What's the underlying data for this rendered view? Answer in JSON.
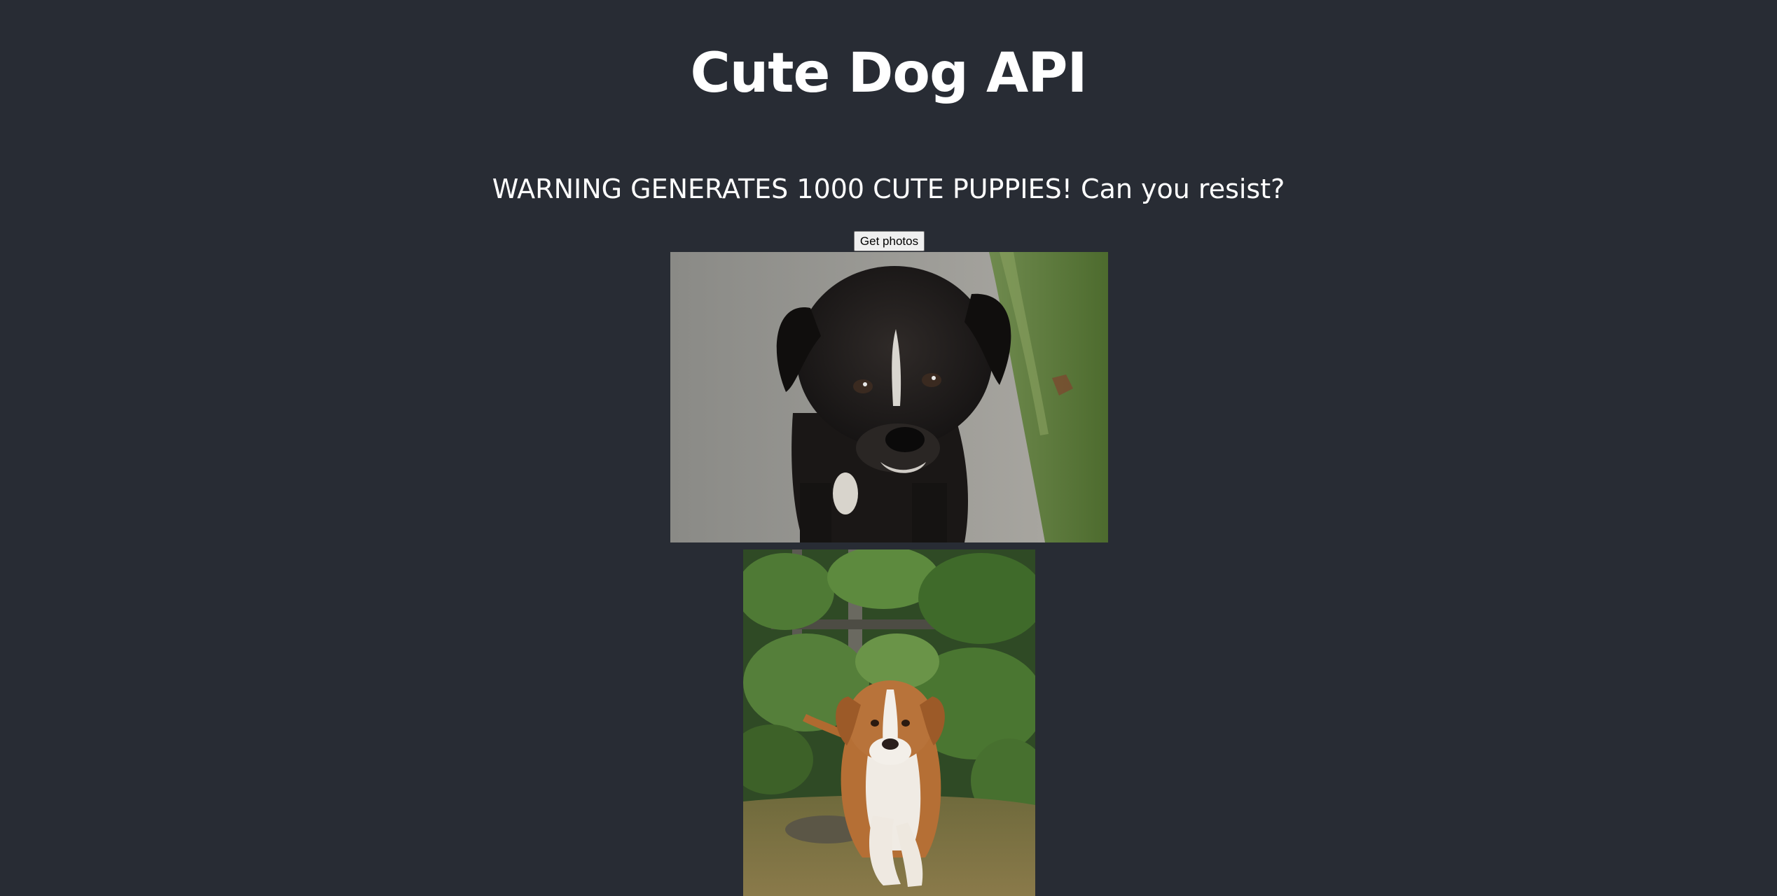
{
  "header": {
    "title": "Cute Dog API"
  },
  "main": {
    "warning": "WARNING GENERATES 1000 CUTE PUPPIES! Can you resist?",
    "get_photos_label": "Get photos"
  },
  "photos": [
    {
      "subject": "black brindle puppy on path"
    },
    {
      "subject": "tan and white puppy walking through garden"
    }
  ],
  "colors": {
    "background": "#282c34",
    "text": "#ffffff",
    "button_bg": "#efefef"
  }
}
